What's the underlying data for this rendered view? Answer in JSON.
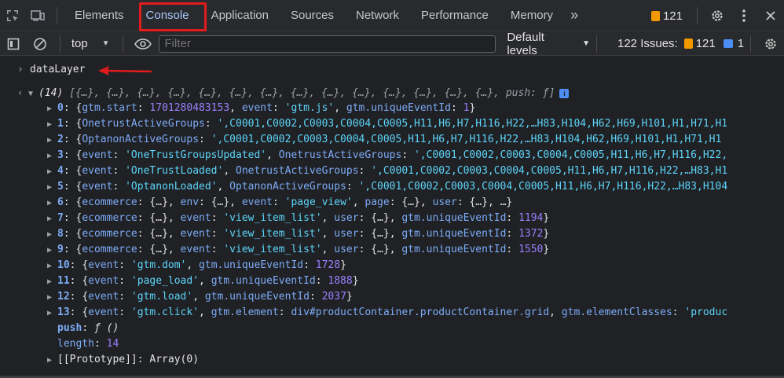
{
  "tabs": [
    "Elements",
    "Console",
    "Application",
    "Sources",
    "Network",
    "Performance",
    "Memory"
  ],
  "more_tabs": "»",
  "issue_count_top": "121",
  "toolbar": {
    "context": "top",
    "filter_placeholder": "Filter",
    "levels": "Default levels",
    "issues_label": "122 Issues:",
    "issues_warn": "121",
    "issues_info": "1"
  },
  "console": {
    "input": "dataLayer",
    "summary_count": "(14)",
    "summary_items": "[{…}, {…}, {…}, {…}, {…}, {…}, {…}, {…}, {…}, {…}, {…}, {…}, {…}, {…},",
    "summary_push": "push: ƒ]",
    "info_badge": "i",
    "entries": [
      {
        "idx": "0",
        "parts": [
          [
            "w",
            "{"
          ],
          [
            "k",
            "gtm.start"
          ],
          [
            "w",
            ": "
          ],
          [
            "n",
            "1701280483153"
          ],
          [
            "w",
            ", "
          ],
          [
            "k",
            "event"
          ],
          [
            "w",
            ": "
          ],
          [
            "s",
            "'gtm.js'"
          ],
          [
            "w",
            ", "
          ],
          [
            "k",
            "gtm.uniqueEventId"
          ],
          [
            "w",
            ": "
          ],
          [
            "n",
            "1"
          ],
          [
            "w",
            "}"
          ]
        ]
      },
      {
        "idx": "1",
        "parts": [
          [
            "w",
            "{"
          ],
          [
            "k",
            "OnetrustActiveGroups"
          ],
          [
            "w",
            ": "
          ],
          [
            "s",
            "',C0001,C0002,C0003,C0004,C0005,H11,H6,H7,H116,H22,…H83,H104,H62,H69,H101,H1,H71,H1"
          ]
        ]
      },
      {
        "idx": "2",
        "parts": [
          [
            "w",
            "{"
          ],
          [
            "k",
            "OptanonActiveGroups"
          ],
          [
            "w",
            ": "
          ],
          [
            "s",
            "',C0001,C0002,C0003,C0004,C0005,H11,H6,H7,H116,H22,…H83,H104,H62,H69,H101,H1,H71,H1"
          ]
        ]
      },
      {
        "idx": "3",
        "parts": [
          [
            "w",
            "{"
          ],
          [
            "k",
            "event"
          ],
          [
            "w",
            ": "
          ],
          [
            "s",
            "'OneTrustGroupsUpdated'"
          ],
          [
            "w",
            ", "
          ],
          [
            "k",
            "OnetrustActiveGroups"
          ],
          [
            "w",
            ": "
          ],
          [
            "s",
            "',C0001,C0002,C0003,C0004,C0005,H11,H6,H7,H116,H22,"
          ]
        ]
      },
      {
        "idx": "4",
        "parts": [
          [
            "w",
            "{"
          ],
          [
            "k",
            "event"
          ],
          [
            "w",
            ": "
          ],
          [
            "s",
            "'OneTrustLoaded'"
          ],
          [
            "w",
            ", "
          ],
          [
            "k",
            "OnetrustActiveGroups"
          ],
          [
            "w",
            ": "
          ],
          [
            "s",
            "',C0001,C0002,C0003,C0004,C0005,H11,H6,H7,H116,H22,…H83,H1"
          ]
        ]
      },
      {
        "idx": "5",
        "parts": [
          [
            "w",
            "{"
          ],
          [
            "k",
            "event"
          ],
          [
            "w",
            ": "
          ],
          [
            "s",
            "'OptanonLoaded'"
          ],
          [
            "w",
            ", "
          ],
          [
            "k",
            "OptanonActiveGroups"
          ],
          [
            "w",
            ": "
          ],
          [
            "s",
            "',C0001,C0002,C0003,C0004,C0005,H11,H6,H7,H116,H22,…H83,H104"
          ]
        ]
      },
      {
        "idx": "6",
        "parts": [
          [
            "w",
            "{"
          ],
          [
            "k",
            "ecommerce"
          ],
          [
            "w",
            ": {…}, "
          ],
          [
            "k",
            "env"
          ],
          [
            "w",
            ": {…}, "
          ],
          [
            "k",
            "event"
          ],
          [
            "w",
            ": "
          ],
          [
            "s",
            "'page_view'"
          ],
          [
            "w",
            ", "
          ],
          [
            "k",
            "page"
          ],
          [
            "w",
            ": {…}, "
          ],
          [
            "k",
            "user"
          ],
          [
            "w",
            ": {…}, …}"
          ]
        ]
      },
      {
        "idx": "7",
        "parts": [
          [
            "w",
            "{"
          ],
          [
            "k",
            "ecommerce"
          ],
          [
            "w",
            ": {…}, "
          ],
          [
            "k",
            "event"
          ],
          [
            "w",
            ": "
          ],
          [
            "s",
            "'view_item_list'"
          ],
          [
            "w",
            ", "
          ],
          [
            "k",
            "user"
          ],
          [
            "w",
            ": {…}, "
          ],
          [
            "k",
            "gtm.uniqueEventId"
          ],
          [
            "w",
            ": "
          ],
          [
            "n",
            "1194"
          ],
          [
            "w",
            "}"
          ]
        ]
      },
      {
        "idx": "8",
        "parts": [
          [
            "w",
            "{"
          ],
          [
            "k",
            "ecommerce"
          ],
          [
            "w",
            ": {…}, "
          ],
          [
            "k",
            "event"
          ],
          [
            "w",
            ": "
          ],
          [
            "s",
            "'view_item_list'"
          ],
          [
            "w",
            ", "
          ],
          [
            "k",
            "user"
          ],
          [
            "w",
            ": {…}, "
          ],
          [
            "k",
            "gtm.uniqueEventId"
          ],
          [
            "w",
            ": "
          ],
          [
            "n",
            "1372"
          ],
          [
            "w",
            "}"
          ]
        ]
      },
      {
        "idx": "9",
        "parts": [
          [
            "w",
            "{"
          ],
          [
            "k",
            "ecommerce"
          ],
          [
            "w",
            ": {…}, "
          ],
          [
            "k",
            "event"
          ],
          [
            "w",
            ": "
          ],
          [
            "s",
            "'view_item_list'"
          ],
          [
            "w",
            ", "
          ],
          [
            "k",
            "user"
          ],
          [
            "w",
            ": {…}, "
          ],
          [
            "k",
            "gtm.uniqueEventId"
          ],
          [
            "w",
            ": "
          ],
          [
            "n",
            "1550"
          ],
          [
            "w",
            "}"
          ]
        ]
      },
      {
        "idx": "10",
        "parts": [
          [
            "w",
            "{"
          ],
          [
            "k",
            "event"
          ],
          [
            "w",
            ": "
          ],
          [
            "s",
            "'gtm.dom'"
          ],
          [
            "w",
            ", "
          ],
          [
            "k",
            "gtm.uniqueEventId"
          ],
          [
            "w",
            ": "
          ],
          [
            "n",
            "1728"
          ],
          [
            "w",
            "}"
          ]
        ]
      },
      {
        "idx": "11",
        "parts": [
          [
            "w",
            "{"
          ],
          [
            "k",
            "event"
          ],
          [
            "w",
            ": "
          ],
          [
            "s",
            "'page_load'"
          ],
          [
            "w",
            ", "
          ],
          [
            "k",
            "gtm.uniqueEventId"
          ],
          [
            "w",
            ": "
          ],
          [
            "n",
            "1888"
          ],
          [
            "w",
            "}"
          ]
        ]
      },
      {
        "idx": "12",
        "parts": [
          [
            "w",
            "{"
          ],
          [
            "k",
            "event"
          ],
          [
            "w",
            ": "
          ],
          [
            "s",
            "'gtm.load'"
          ],
          [
            "w",
            ", "
          ],
          [
            "k",
            "gtm.uniqueEventId"
          ],
          [
            "w",
            ": "
          ],
          [
            "n",
            "2037"
          ],
          [
            "w",
            "}"
          ]
        ]
      },
      {
        "idx": "13",
        "parts": [
          [
            "w",
            "{"
          ],
          [
            "k",
            "event"
          ],
          [
            "w",
            ": "
          ],
          [
            "s",
            "'gtm.click'"
          ],
          [
            "w",
            ", "
          ],
          [
            "k",
            "gtm.element"
          ],
          [
            "w",
            ": "
          ],
          [
            "k",
            "div#productContainer.productContainer.grid"
          ],
          [
            "w",
            ", "
          ],
          [
            "k",
            "gtm.elementClasses"
          ],
          [
            "w",
            ": "
          ],
          [
            "s",
            "'produc"
          ]
        ]
      }
    ],
    "push_key": "push",
    "push_val": "ƒ ()",
    "length_key": "length",
    "length_val": "14",
    "prototype_key": "[[Prototype]]",
    "prototype_val": "Array(0)"
  },
  "colors": {
    "highlight": "#e11c1c",
    "accent": "#a8c7fa",
    "warning": "#f29900"
  }
}
